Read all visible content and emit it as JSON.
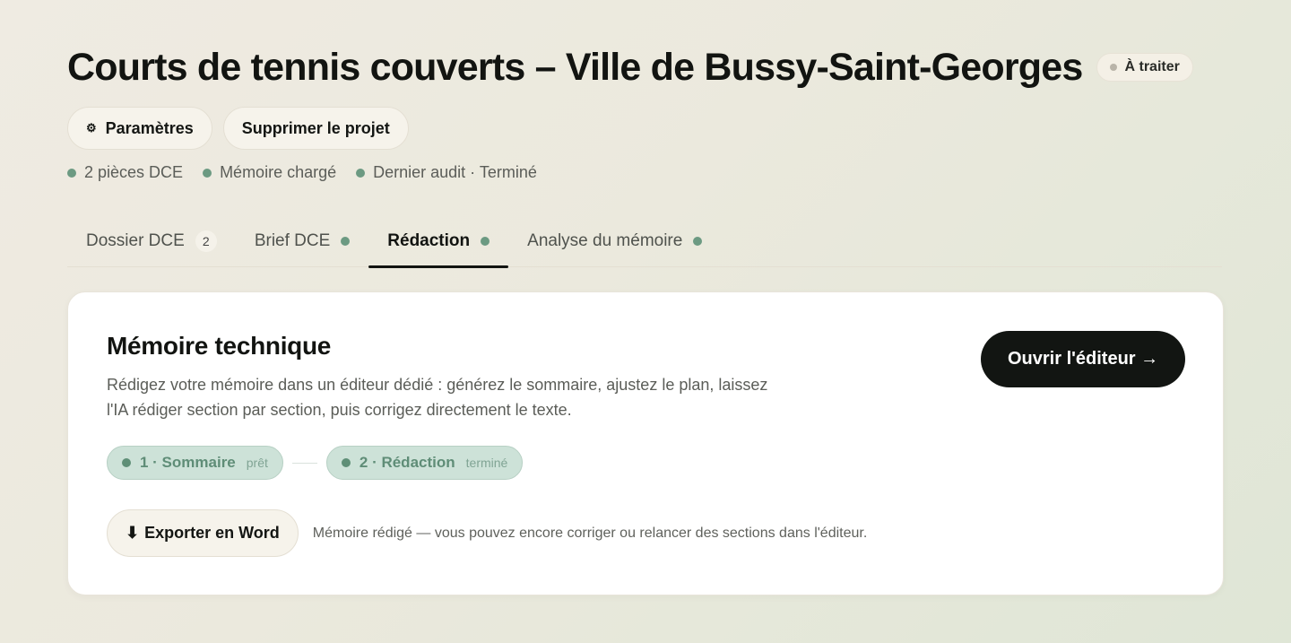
{
  "header": {
    "title": "Courts de tennis couverts – Ville de Bussy-Saint-Georges",
    "status_badge": "À traiter",
    "settings_label": "Paramètres",
    "settings_icon": "⚙",
    "delete_label": "Supprimer le projet"
  },
  "meta": {
    "items": [
      {
        "label": "2 pièces DCE"
      },
      {
        "label": "Mémoire chargé"
      },
      {
        "label": "Dernier audit · Terminé"
      }
    ]
  },
  "tabs": [
    {
      "label": "Dossier DCE",
      "count": "2"
    },
    {
      "label": "Brief DCE"
    },
    {
      "label": "Rédaction",
      "active": true
    },
    {
      "label": "Analyse du mémoire"
    }
  ],
  "card": {
    "title": "Mémoire technique",
    "description": "Rédigez votre mémoire dans un éditeur dédié : générez le sommaire, ajustez le plan, laissez l'IA rédiger section par section, puis corrigez directement le texte.",
    "open_editor_label": "Ouvrir l'éditeur →",
    "steps": [
      {
        "label": "1 · Sommaire",
        "state": "prêt"
      },
      {
        "label": "2 · Rédaction",
        "state": "terminé"
      }
    ],
    "export_icon": "⬇",
    "export_label": "Exporter en Word",
    "export_note": "Mémoire rédigé — vous pouvez encore corriger ou relancer des sections dans l'éditeur."
  },
  "colors": {
    "accent_green": "#6c9a82",
    "step_bg": "#cde2d8",
    "primary_button": "#121512"
  }
}
